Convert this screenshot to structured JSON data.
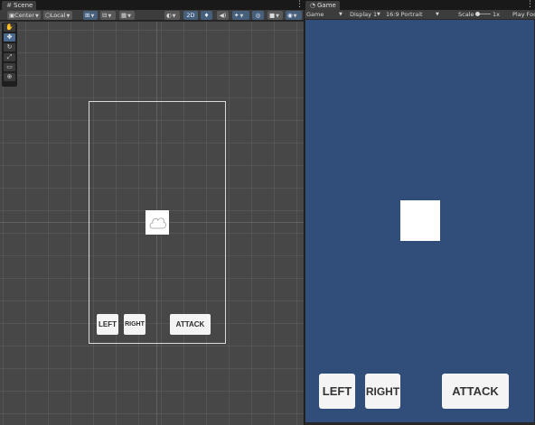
{
  "scene": {
    "tab_label": "Scene",
    "menu_icon": "⋮",
    "toolbar": {
      "pivot_label": "Center",
      "space_label": "Local",
      "mode_2d_label": "2D"
    },
    "tools": [
      "hand-tool",
      "move-tool",
      "rotate-tool",
      "scale-tool",
      "rect-tool",
      "transform-tool"
    ],
    "buttons": {
      "left": "LEFT",
      "right": "RIGHT",
      "attack": "ATTACK"
    }
  },
  "game": {
    "tab_label": "Game",
    "menu_icon": "⋮",
    "toolbar": {
      "view_select": "Game",
      "display_select": "Display 1",
      "aspect_select": "16:9 Portrait",
      "scale_label": "Scale",
      "scale_value": "1x",
      "play_focused": "Play Foc"
    },
    "buttons": {
      "left": "LEFT",
      "right": "RIGHT",
      "attack": "ATTACK"
    }
  },
  "colors": {
    "game_background": "#314d79",
    "scene_background": "#474747",
    "active_tool": "#4a6a8e"
  }
}
